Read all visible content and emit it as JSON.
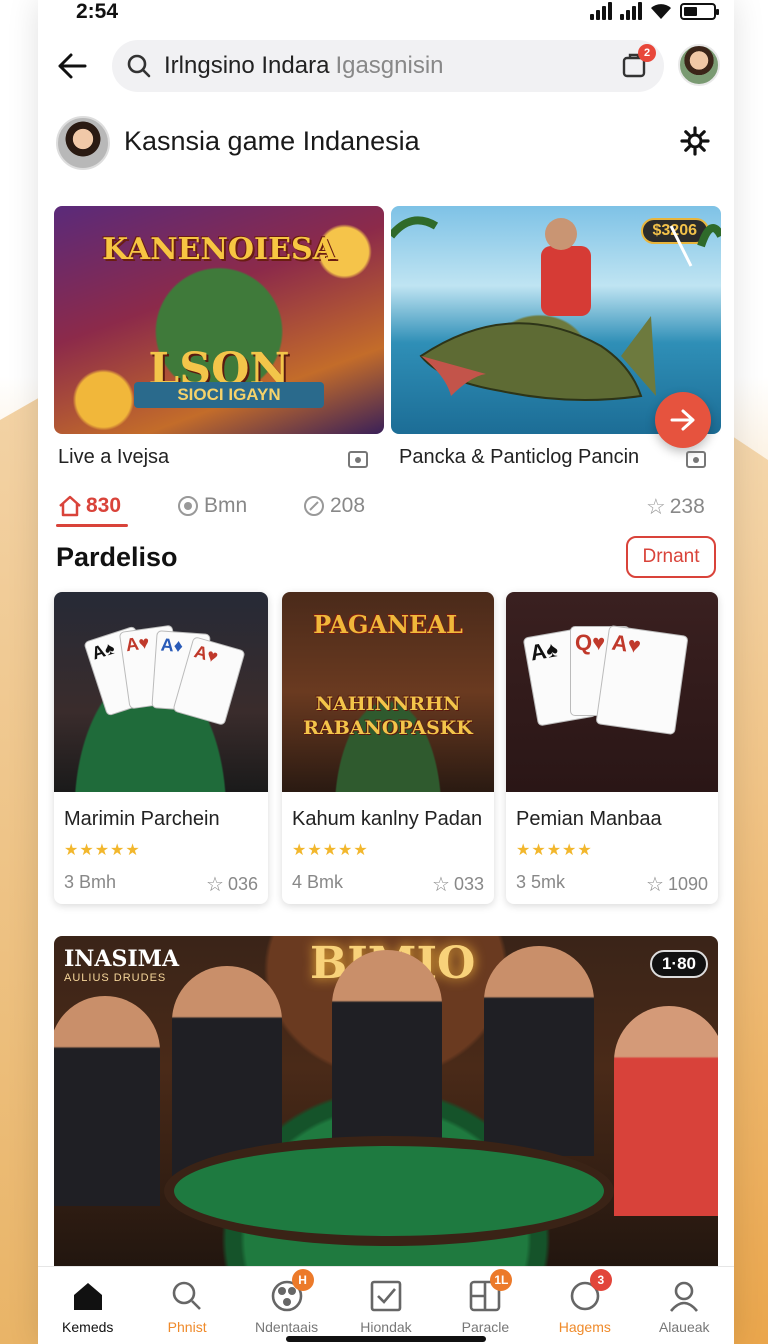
{
  "status_bar": {
    "time": "2:54"
  },
  "header": {
    "search_text": "Irlngsino Indara",
    "search_placeholder": "Igasgnisin",
    "notif_count": "2"
  },
  "profile": {
    "title": "Kasnsia game Indanesia"
  },
  "hero_cards": [
    {
      "caption": "Live a Ivejsa",
      "banner_top": "KANENOIESA",
      "banner_mid": "LSON",
      "banner_low": "SIOCI IGAYN"
    },
    {
      "caption": "Pancka & Panticlog Pancin",
      "price": "$3206"
    }
  ],
  "stats": [
    {
      "value": "830",
      "active": true
    },
    {
      "value": "Bmn"
    },
    {
      "value": "208"
    },
    {
      "value": "238"
    }
  ],
  "section": {
    "title": "Pardeliso",
    "button": "Drnant"
  },
  "game_cards": [
    {
      "title": "Marimin Parchein",
      "meta": "3 Bmh",
      "count": "036",
      "stars": "★★★★★"
    },
    {
      "title": "Kahum kanlny Padan",
      "meta": "4 Bmk",
      "count": "033",
      "stars": "★★★★★",
      "banner_top": "PAGANEAL",
      "banner": "NAHINNRHN RABANOPASKK"
    },
    {
      "title": "Pemian Manbaa",
      "meta": "3 5mk",
      "count": "1090",
      "stars": "★★★★★"
    }
  ],
  "live_banner": {
    "brand": "INASIMA",
    "brand_sub": "AULIUS DRUDES",
    "sign": "BIMIO",
    "badge": "1·80"
  },
  "bottom_nav": [
    {
      "label": "Kemeds",
      "icon": "home-icon",
      "active": true
    },
    {
      "label": "Phnist",
      "icon": "search-icon",
      "orange": true
    },
    {
      "label": "Ndentaais",
      "icon": "reel-icon",
      "badge": "H"
    },
    {
      "label": "Hiondak",
      "icon": "checkbox-icon"
    },
    {
      "label": "Paracle",
      "icon": "grid-icon",
      "badge": "1L"
    },
    {
      "label": "Hagems",
      "icon": "chat-icon",
      "orange": true,
      "badge": "3"
    },
    {
      "label": "Alaueak",
      "icon": "profile-icon"
    }
  ],
  "colors": {
    "accent": "#d9433a",
    "orange": "#ef8a2a",
    "star": "#f2b72d"
  }
}
